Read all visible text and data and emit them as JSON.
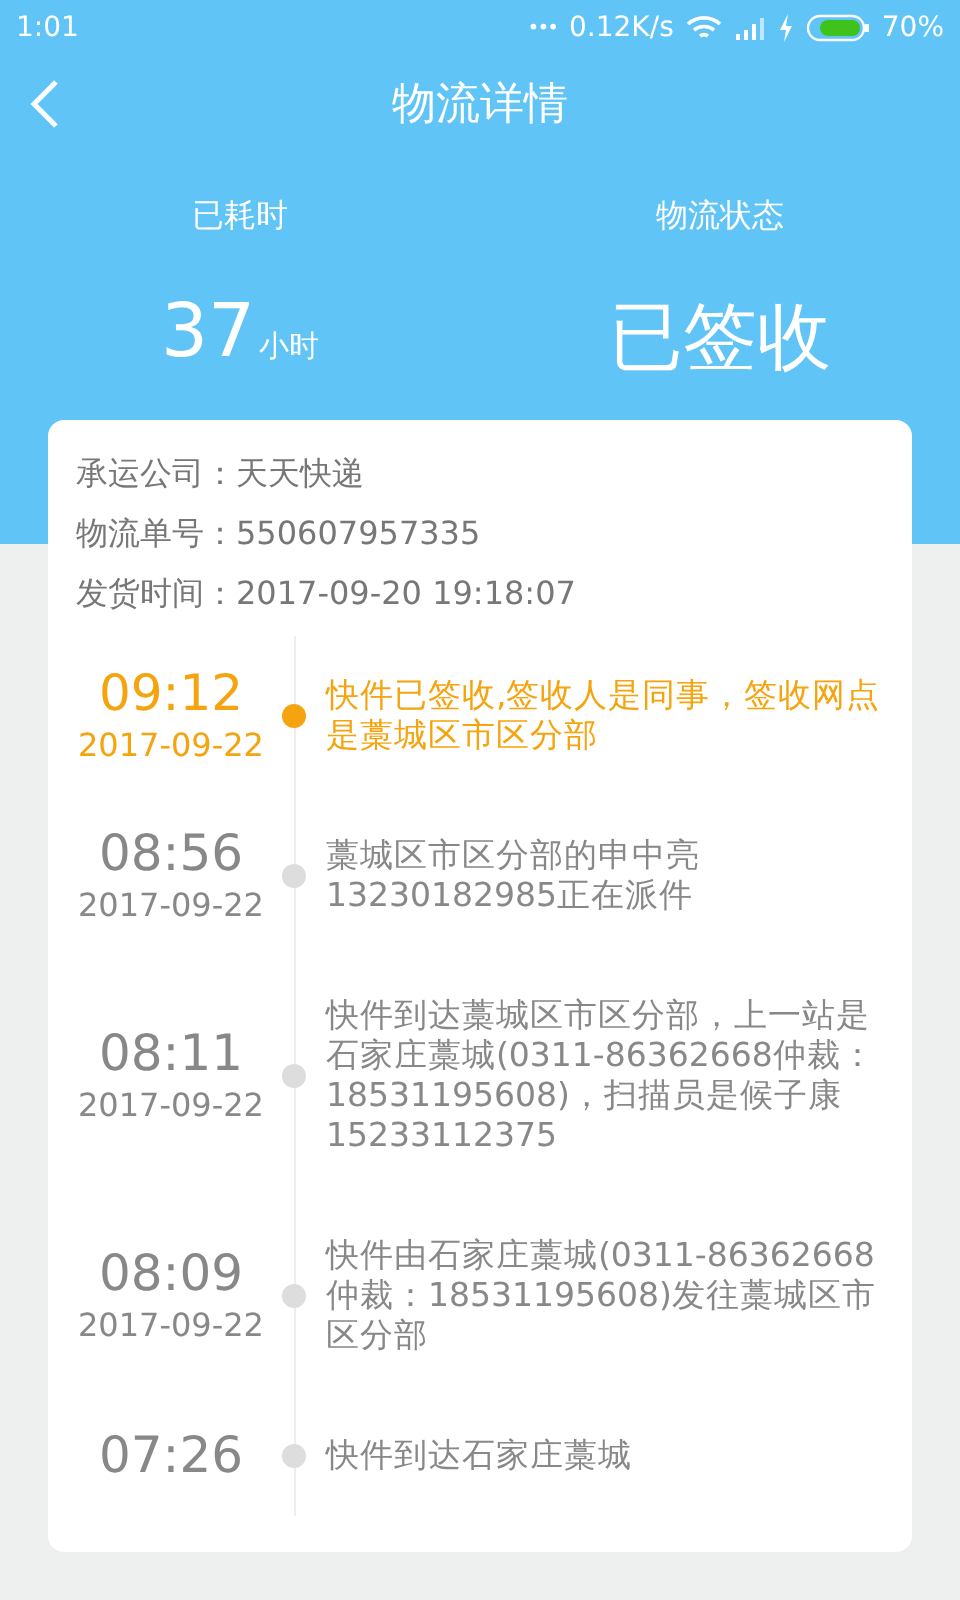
{
  "status_bar": {
    "time": "1:01",
    "dots": "•••",
    "speed": "0.12K/s",
    "battery": "70%"
  },
  "header": {
    "title": "物流详情"
  },
  "summary": [
    {
      "label": "已耗时",
      "value": "37",
      "unit": "小时"
    },
    {
      "label": "物流状态",
      "value": "已签收"
    }
  ],
  "info": [
    "承运公司：天天快递",
    "物流单号：550607957335",
    "发货时间：2017-09-20 19:18:07"
  ],
  "events": [
    {
      "time": "09:12",
      "date": "2017-09-22",
      "text": "快件已签收,签收人是同事，签收网点是藁城区市区分部",
      "current": true
    },
    {
      "time": "08:56",
      "date": "2017-09-22",
      "text": "藁城区市区分部的申中亮13230182985正在派件",
      "current": false
    },
    {
      "time": "08:11",
      "date": "2017-09-22",
      "text": "快件到达藁城区市区分部，上一站是石家庄藁城(0311-86362668仲裁：18531195608)，扫描员是候子康15233112375",
      "current": false
    },
    {
      "time": "08:09",
      "date": "2017-09-22",
      "text": "快件由石家庄藁城(0311-86362668仲裁：18531195608)发往藁城区市区分部",
      "current": false
    },
    {
      "time": "07:26",
      "text": "快件到达石家庄藁城",
      "current": false
    }
  ]
}
